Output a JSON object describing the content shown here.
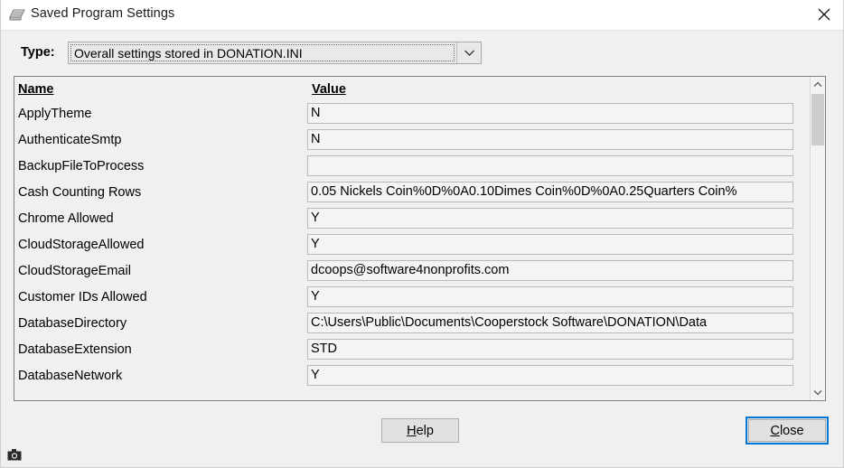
{
  "window": {
    "title": "Saved Program Settings",
    "icon": "settings-list-icon",
    "close_icon": "close-x-icon",
    "bg_color": "#f0f0f0",
    "titlebar_color": "#ffffff"
  },
  "type_row": {
    "label": "Type:",
    "selected_option": "Overall settings stored in DONATION.INI",
    "arrow_icon": "chevron-down-icon"
  },
  "list": {
    "headers": {
      "name": "Name",
      "value": "Value"
    },
    "rows": [
      {
        "name": "ApplyTheme",
        "value": "N"
      },
      {
        "name": "AuthenticateSmtp",
        "value": "N"
      },
      {
        "name": "BackupFileToProcess",
        "value": ""
      },
      {
        "name": "Cash Counting Rows",
        "value": "0.05 Nickels Coin%0D%0A0.10Dimes Coin%0D%0A0.25Quarters Coin%"
      },
      {
        "name": "Chrome Allowed",
        "value": "Y"
      },
      {
        "name": "CloudStorageAllowed",
        "value": "Y"
      },
      {
        "name": "CloudStorageEmail",
        "value": "dcoops@software4nonprofits.com"
      },
      {
        "name": "Customer IDs Allowed",
        "value": "Y"
      },
      {
        "name": "DatabaseDirectory",
        "value": "C:\\Users\\Public\\Documents\\Cooperstock Software\\DONATION\\Data"
      },
      {
        "name": "DatabaseExtension",
        "value": "STD"
      },
      {
        "name": "DatabaseNetwork",
        "value": "Y"
      }
    ],
    "scrollbar": {
      "up_icon": "chevron-up-icon",
      "down_icon": "chevron-down-icon",
      "thumb_color": "#cdcdcd"
    }
  },
  "buttons": {
    "help": {
      "label": "Help",
      "accel": "H"
    },
    "close": {
      "label": "Close",
      "accel": "C",
      "focus_color": "#0078d7"
    }
  },
  "status": {
    "camera_icon": "camera-icon"
  }
}
